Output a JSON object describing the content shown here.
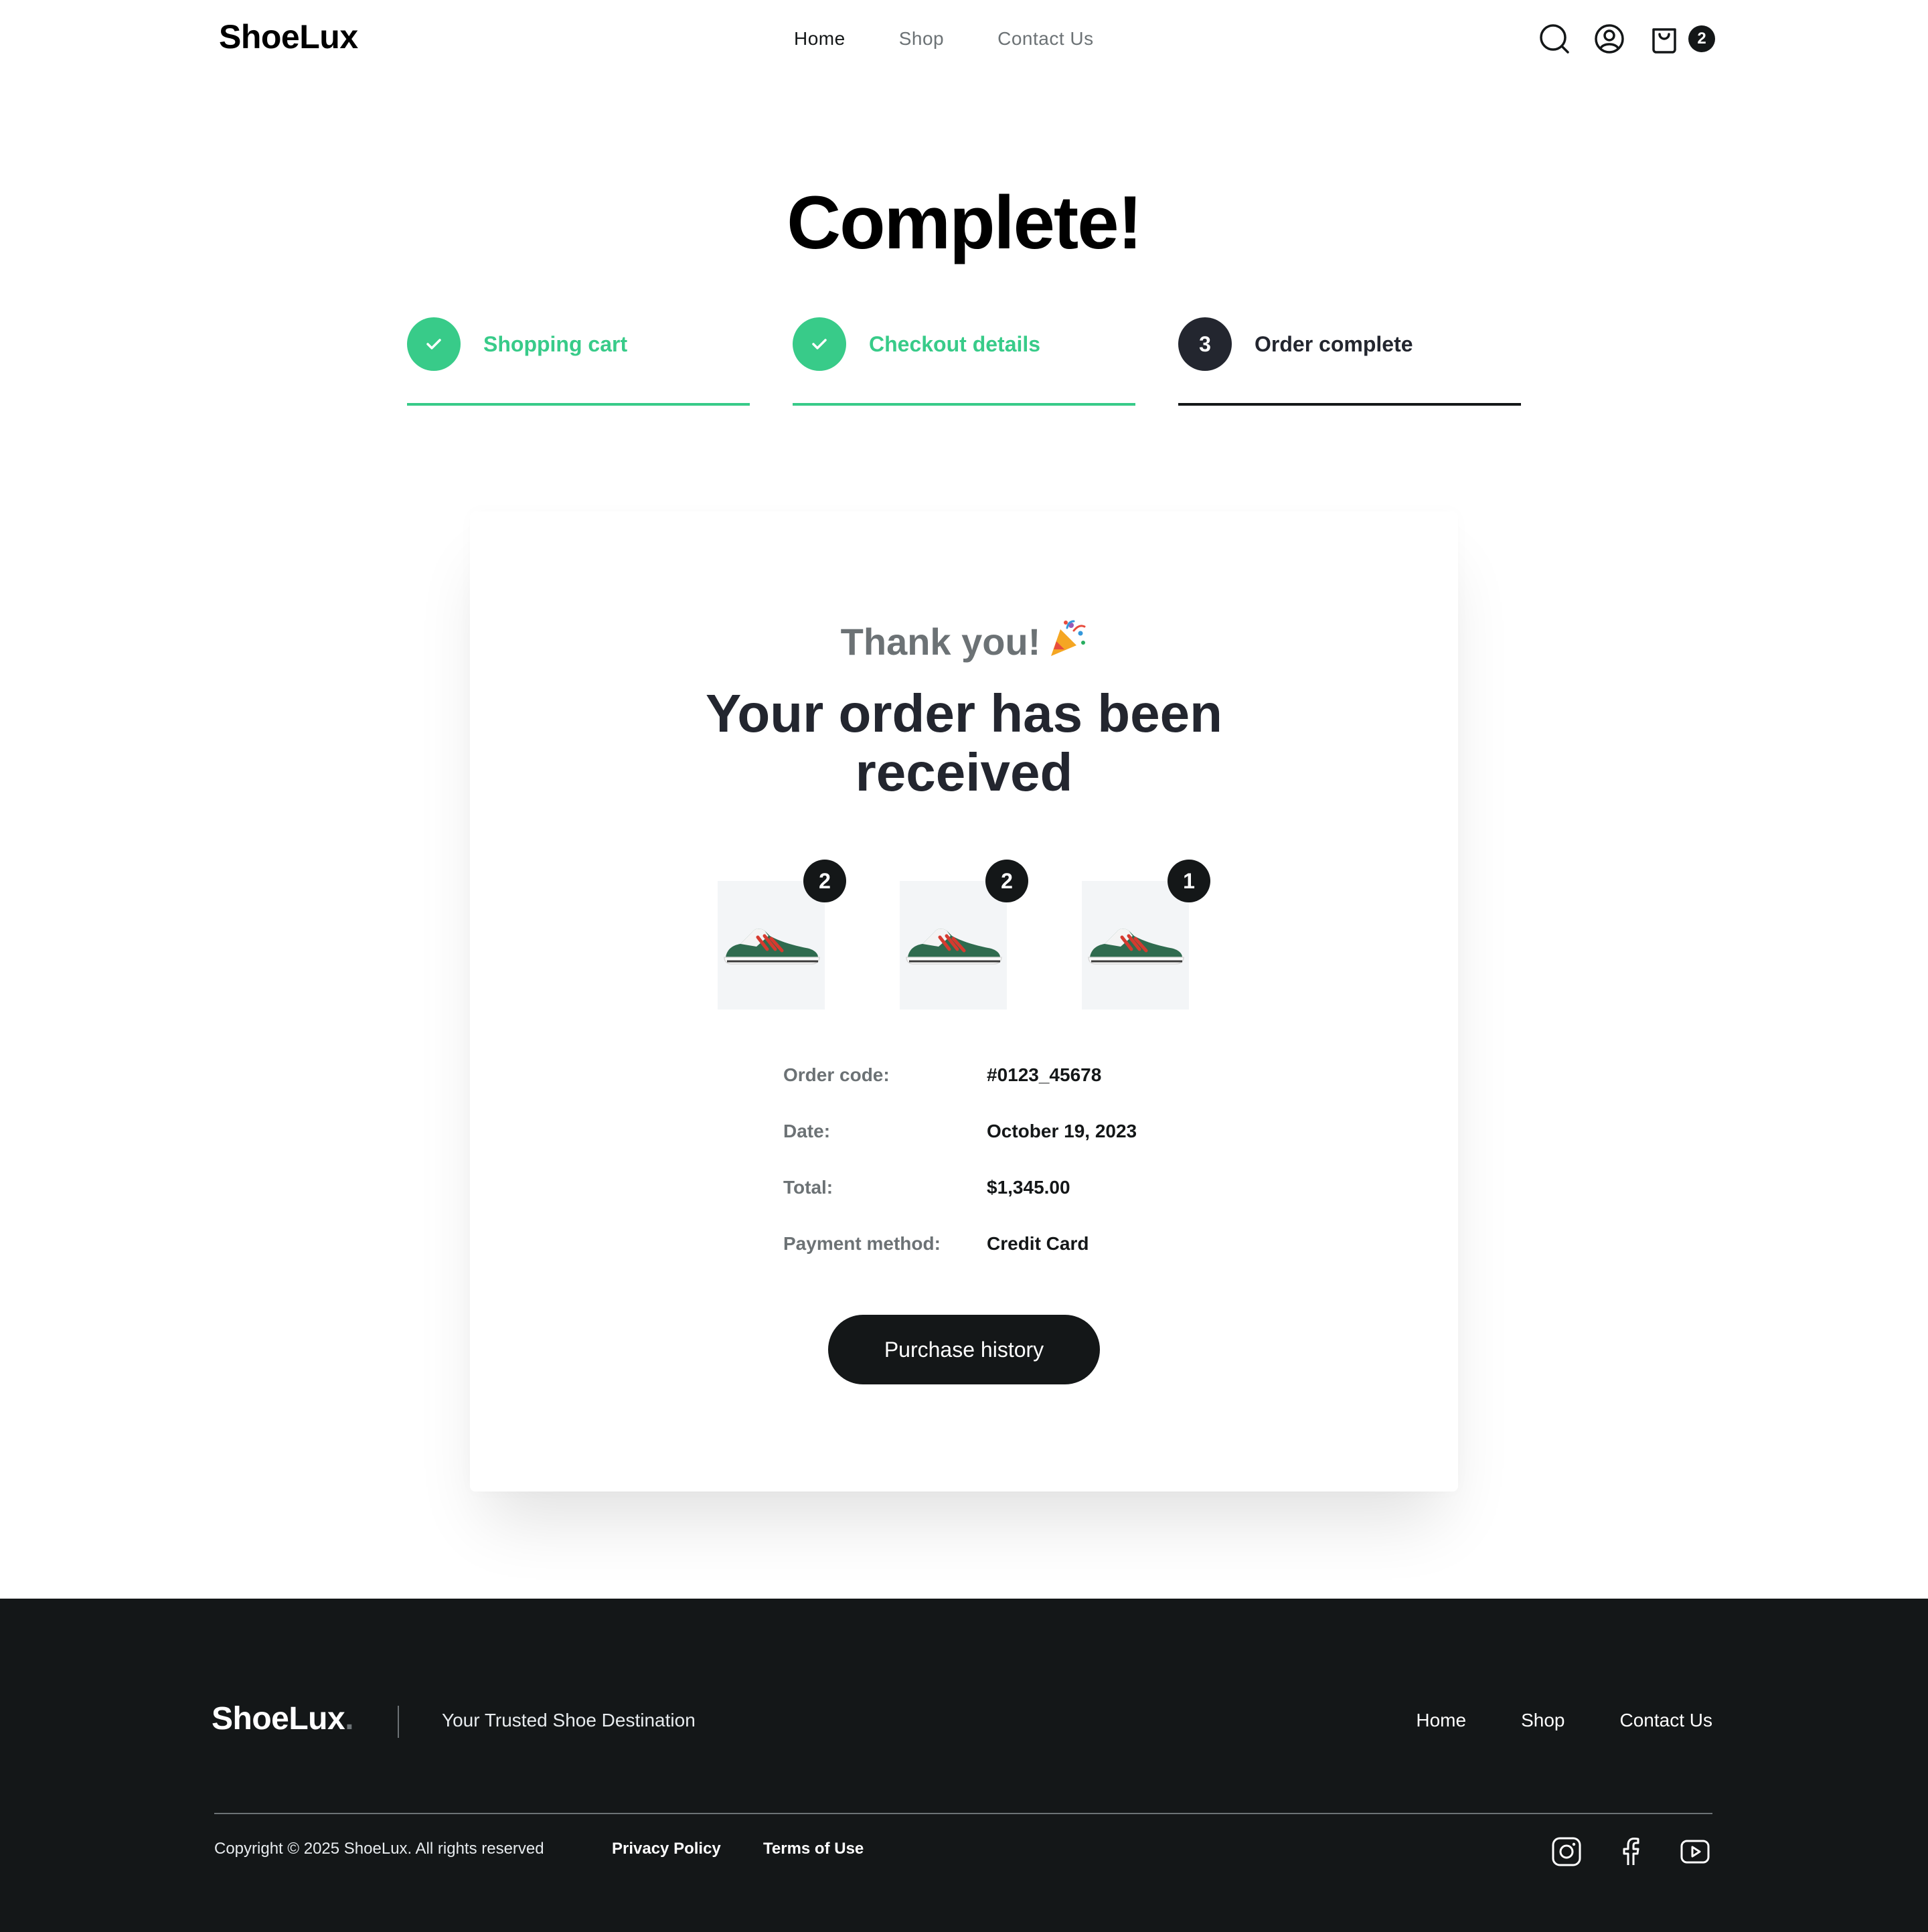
{
  "brand": {
    "name": "ShoeLux"
  },
  "nav": {
    "items": [
      "Home",
      "Shop",
      "Contact Us"
    ],
    "active": "Home"
  },
  "header": {
    "icons": [
      "search-icon",
      "user-icon",
      "bag-icon"
    ],
    "cart_count": "2"
  },
  "page": {
    "title": "Complete!"
  },
  "steps": [
    {
      "number": "1",
      "label": "Shopping cart",
      "state": "done"
    },
    {
      "number": "2",
      "label": "Checkout details",
      "state": "done"
    },
    {
      "number": "3",
      "label": "Order complete",
      "state": "current"
    }
  ],
  "order": {
    "thanks": "Thank you!",
    "thanks_emoji": "party-popper-icon",
    "headline_line1": "Your order has been",
    "headline_line2": "received",
    "items": [
      {
        "qty": "2",
        "image": "sneaker-green-red-stripes"
      },
      {
        "qty": "2",
        "image": "sneaker-green-red-stripes"
      },
      {
        "qty": "1",
        "image": "sneaker-green-red-stripes"
      }
    ],
    "details": [
      {
        "label": "Order code:",
        "value": "#0123_45678"
      },
      {
        "label": "Date:",
        "value": "October 19, 2023"
      },
      {
        "label": "Total:",
        "value": "$1,345.00"
      },
      {
        "label": "Payment method:",
        "value": "Credit Card"
      }
    ],
    "button_label": "Purchase history"
  },
  "footer": {
    "logo": "ShoeLux",
    "logo_dot": ".",
    "tagline": "Your Trusted Shoe Destination",
    "nav": [
      "Home",
      "Shop",
      "Contact Us"
    ],
    "copyright": "Copyright © 2025 ShoeLux. All rights reserved",
    "privacy": "Privacy Policy",
    "terms": "Terms of Use",
    "social": [
      "instagram-icon",
      "facebook-icon",
      "youtube-icon"
    ]
  },
  "colors": {
    "accent_green": "#38CB89",
    "dark": "#141718",
    "muted": "#6C7275"
  }
}
